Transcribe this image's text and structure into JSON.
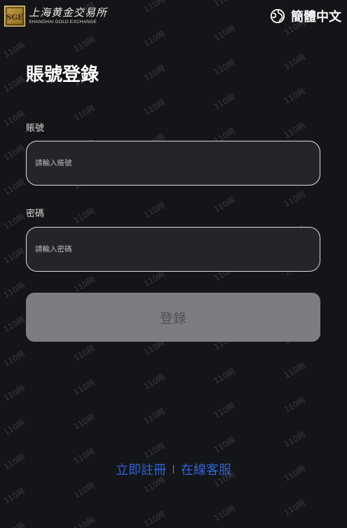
{
  "header": {
    "logo_cn": "上海黄金交易所",
    "logo_en": "SHANGHAI GOLD EXCHANGE",
    "logo_mark": "SGE",
    "language_label": "簡體中文",
    "language_icon": "globe-icon"
  },
  "login": {
    "title": "賬號登錄",
    "account_label": "賬號",
    "account_placeholder": "請輸入賬號",
    "account_value": "",
    "password_label": "密碼",
    "password_placeholder": "請輸入密碼",
    "password_value": "",
    "submit_label": "登錄"
  },
  "footer": {
    "register_label": "立即註冊",
    "service_label": "在線客服"
  },
  "watermark_text": "110网",
  "colors": {
    "background": "#141518",
    "input_background": "#23252a",
    "button_background": "#7c7d80",
    "link": "#2f63d6"
  }
}
